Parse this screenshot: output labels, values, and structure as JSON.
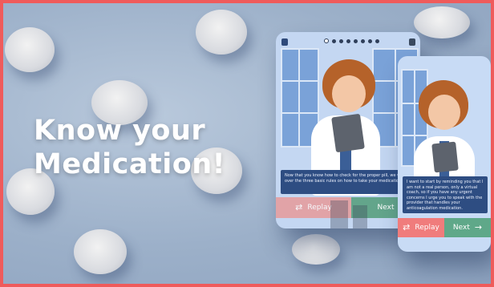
{
  "headline": {
    "line1": "Know your",
    "line2": "Medication!"
  },
  "phone_back": {
    "menu_icon": "menu-icon",
    "trash_icon": "trash-icon",
    "progress_steps": 8,
    "progress_active": 0,
    "dialog_text": "Now that you know how to check for the proper pill, we will go over the three basic rules on how to take your medication.",
    "replay_label": "Replay",
    "next_label": "Next"
  },
  "phone_front": {
    "dialog_text": "I want to start by reminding you that I am not a real person, only a virtual coach, so if you have any urgent concerns I urge you to speak with the provider that handles your anticoagulation medication.",
    "replay_label": "Replay",
    "next_label": "Next"
  },
  "colors": {
    "border": "#ef5b5b",
    "replay": "#f07c7c",
    "next": "#5fa889",
    "dialog": "#2e4d82"
  }
}
